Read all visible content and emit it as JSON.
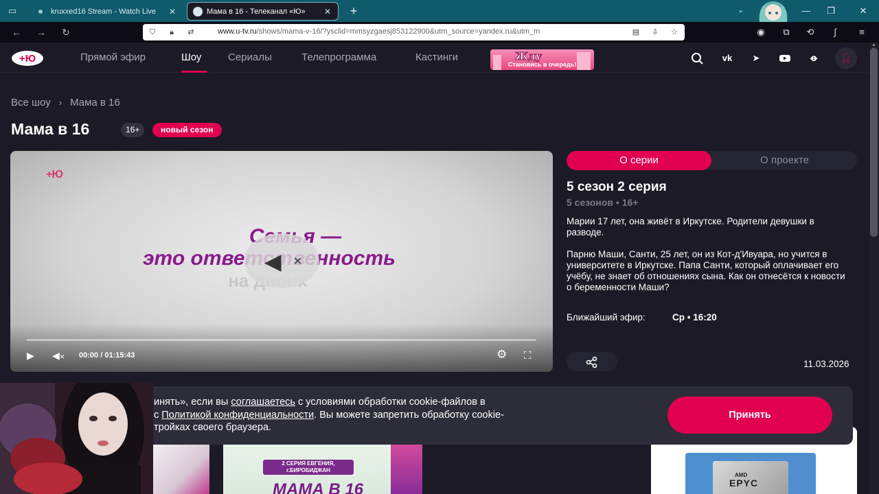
{
  "browser": {
    "tabs": [
      {
        "title": "kruxxed16 Stream - Watch Live",
        "active": false
      },
      {
        "title": "Мама в 16 - Телеканал «Ю»",
        "active": true
      }
    ],
    "url_host": "www.u-tv.ru",
    "url_path": "/shows/mama-v-16/?ysclid=mmsyzgaesj853122900&utm_source=yandex.ru&utm_m",
    "new_tab_symbol": "+",
    "window_controls": [
      "minimize",
      "restore",
      "close"
    ]
  },
  "site": {
    "logo": "+Ю",
    "menu": [
      {
        "label": "Прямой эфир",
        "active": false
      },
      {
        "label": "Шоу",
        "active": true
      },
      {
        "label": "Сериалы",
        "active": false
      },
      {
        "label": "Телепрограмма",
        "active": false
      },
      {
        "label": "Кастинги",
        "active": false
      }
    ],
    "promo": {
      "title": "Жду",
      "subtitle": "Становись в очередь!"
    },
    "header_icons": [
      "search-icon",
      "vk-icon",
      "telegram-icon",
      "youtube-icon",
      "odnoklassniki-icon",
      "user-icon"
    ]
  },
  "page": {
    "breadcrumb": [
      "Все шоу",
      "Мама в 16"
    ],
    "title": "Мама в 16",
    "age_badge": "16+",
    "season_badge": "новый сезон"
  },
  "player": {
    "watermark": "+Ю",
    "slogan_line1": "Семья —",
    "slogan_line2": "это ответственность",
    "slogan_line3": "на двоих",
    "current_time": "00:00",
    "time_separator": "/",
    "duration": "01:15:43",
    "progress_fraction": 0.0,
    "muted": true
  },
  "info": {
    "tabs": [
      "О серии",
      "О проекте"
    ],
    "episode_title": "5 сезон 2 серия",
    "seasons": "5 сезонов",
    "age": "16+",
    "paragraph1": "Марии 17 лет, она живёт в Иркутске. Родители девушки в разводе.",
    "paragraph2": "Парню Маши, Санти, 25 лет, он из Кот-д'Ивуара, но учится в университете в Иркутске. Папа Санти, который оплачивает его учёбу, не знает об отношениях сына. Как он отнесётся к новости о беременности Маши?",
    "next_air_label": "Ближайший эфир:",
    "next_air_day": "Ср",
    "next_air_time": "16:20",
    "date": "11.03.2026"
  },
  "cookie": {
    "part1": "инять», если вы ",
    "link1": "соглашаетесь",
    "part2": " с условиями обработки cookie-файлов в",
    "part3": "с ",
    "link2": "Политикой конфиденциальности",
    "part4": ". Вы можете запретить обработку cookie-",
    "part5": "тройках своего браузера.",
    "accept": "Принять"
  },
  "thumbnails": {
    "thumb2_label": "2 СЕРИЯ ЕВГЕНИЯ, г.БИРОБИДЖАН",
    "thumb2_title": "МАМА В 16"
  },
  "ad": {
    "brand": "AMD",
    "model": "EPYC"
  },
  "colors": {
    "accent": "#e0004f",
    "background": "#1b1a26",
    "browser_tabbar": "#0f5a6b"
  }
}
